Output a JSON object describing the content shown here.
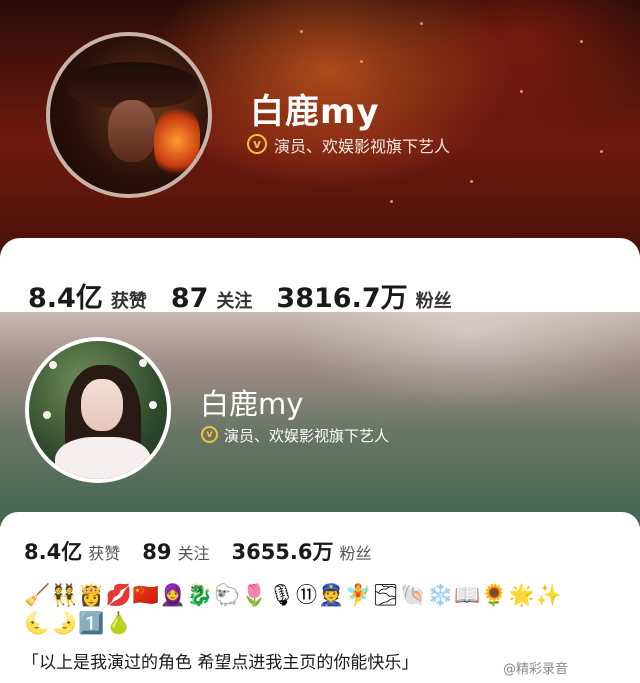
{
  "profile_top": {
    "name": "白鹿my",
    "verified_badge_icon": "v-badge-icon",
    "verification": "演员、欢娱影视旗下艺人",
    "stats": [
      {
        "value": "8.4亿",
        "label": "获赞"
      },
      {
        "value": "87",
        "label": "关注"
      },
      {
        "value": "3816.7万",
        "label": "粉丝"
      }
    ],
    "badge_letter": "v"
  },
  "profile_bottom": {
    "name": "白鹿my",
    "verified_badge_icon": "v-badge-icon",
    "verification": "演员、欢娱影视旗下艺人",
    "stats": [
      {
        "value": "8.4亿",
        "label": "获赞"
      },
      {
        "value": "89",
        "label": "关注"
      },
      {
        "value": "3655.6万",
        "label": "粉丝"
      }
    ],
    "badge_letter": "v",
    "emoji_row_1": "🧹👯👸💋🇨🇳🧕🐉🐑🌷🎙⑪👮🧚🌫🐚❄️📖🌻🌟✨",
    "emoji_row_2": "🌜🌛1️⃣🍐",
    "bio": "「以上是我演过的角色 希望点进我主页的你能快乐」"
  },
  "watermark": "@精彩录音"
}
